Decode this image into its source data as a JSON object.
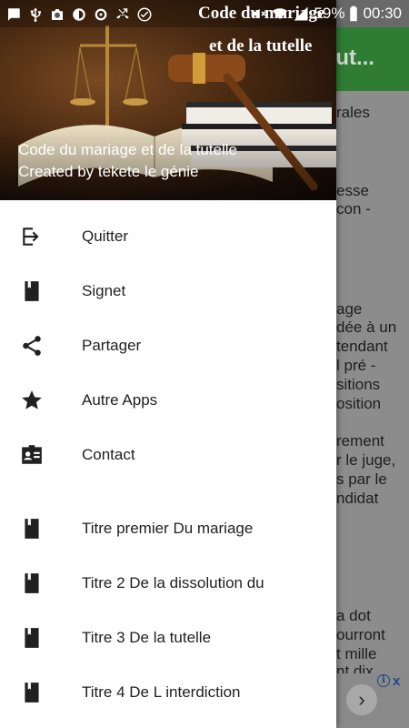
{
  "status_bar": {
    "battery": "59%",
    "time": "00:30",
    "overlay_title": "Code du mariage",
    "icons": [
      "chat-icon",
      "usb-icon",
      "camera-icon",
      "settings-brightness-icon",
      "settings-icon",
      "missed-call-icon",
      "check-circle-icon",
      "mute-icon",
      "wifi-icon",
      "signal-icon",
      "battery-icon"
    ]
  },
  "background_app": {
    "toolbar_title": "n tut...",
    "toolbar_color": "#2e7d32",
    "lines": [
      "rales",
      "esse",
      "con -",
      "age",
      "dée à un",
      "tendant",
      "l pré -",
      "sitions",
      "osition",
      "rement",
      "r le juge,",
      "s par le",
      "ndidat",
      "a dot",
      "ourront",
      "t mille",
      "nt dix"
    ],
    "ad_arrow": "›",
    "ad_info": "i",
    "ad_close": "x"
  },
  "drawer": {
    "header": {
      "art_subtitle": "et de la tutelle",
      "title": "Code du mariage  et de la tutelle",
      "subtitle": "Created by tekete le génie"
    },
    "items": [
      {
        "label": "Quitter",
        "icon": "exit-icon"
      },
      {
        "label": "Signet",
        "icon": "bookmark-book-icon"
      },
      {
        "label": "Partager",
        "icon": "share-icon"
      },
      {
        "label": "Autre Apps",
        "icon": "star-icon"
      },
      {
        "label": "Contact",
        "icon": "contact-card-icon"
      }
    ],
    "chapters": [
      {
        "label": "Titre premier Du mariage",
        "icon": "book-icon"
      },
      {
        "label": "Titre  2 De la dissolution du",
        "icon": "book-icon"
      },
      {
        "label": "Titre 3 De la tutelle",
        "icon": "book-icon"
      },
      {
        "label": "Titre 4 De L interdiction",
        "icon": "book-icon"
      }
    ]
  }
}
